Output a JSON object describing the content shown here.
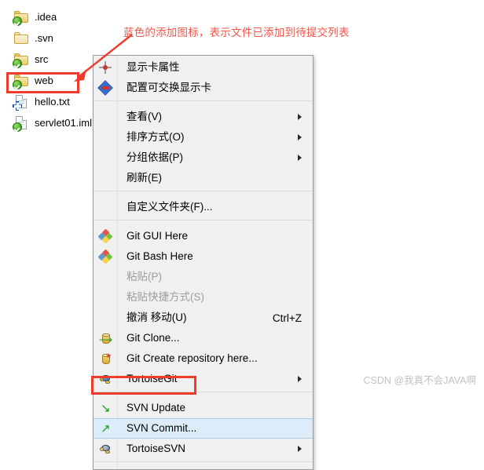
{
  "file_list": {
    "items": [
      {
        "label": ".idea",
        "icon": "folder-icon",
        "overlay": "green-check-overlay-icon"
      },
      {
        "label": ".svn",
        "icon": "folder-icon",
        "overlay": "none"
      },
      {
        "label": "src",
        "icon": "folder-icon",
        "overlay": "green-check-overlay-icon"
      },
      {
        "label": "web",
        "icon": "folder-icon",
        "overlay": "green-check-overlay-icon"
      },
      {
        "label": "hello.txt",
        "icon": "text-file-icon",
        "overlay": "blue-plus-overlay-icon"
      },
      {
        "label": "servlet01.iml",
        "icon": "file-icon",
        "overlay": "green-check-overlay-icon"
      }
    ]
  },
  "context_menu": {
    "items": [
      {
        "label": "显示卡属性",
        "icon": "display-properties-icon",
        "accel": "",
        "arrow": false,
        "disabled": false,
        "highlight": false,
        "separator_before": false
      },
      {
        "label": "配置可交换显示卡",
        "icon": "switchable-graphics-icon",
        "accel": "",
        "arrow": false,
        "disabled": false,
        "highlight": false,
        "separator_before": false
      },
      {
        "label": "查看(V)",
        "icon": "none",
        "accel": "",
        "arrow": true,
        "disabled": false,
        "highlight": false,
        "separator_before": true
      },
      {
        "label": "排序方式(O)",
        "icon": "none",
        "accel": "",
        "arrow": true,
        "disabled": false,
        "highlight": false,
        "separator_before": false
      },
      {
        "label": "分组依据(P)",
        "icon": "none",
        "accel": "",
        "arrow": true,
        "disabled": false,
        "highlight": false,
        "separator_before": false
      },
      {
        "label": "刷新(E)",
        "icon": "none",
        "accel": "",
        "arrow": false,
        "disabled": false,
        "highlight": false,
        "separator_before": false
      },
      {
        "label": "自定义文件夹(F)...",
        "icon": "none",
        "accel": "",
        "arrow": false,
        "disabled": false,
        "highlight": false,
        "separator_before": true
      },
      {
        "label": "Git GUI Here",
        "icon": "git-logo-icon",
        "accel": "",
        "arrow": false,
        "disabled": false,
        "highlight": false,
        "separator_before": true
      },
      {
        "label": "Git Bash Here",
        "icon": "git-logo-icon",
        "accel": "",
        "arrow": false,
        "disabled": false,
        "highlight": false,
        "separator_before": false
      },
      {
        "label": "粘贴(P)",
        "icon": "none",
        "accel": "",
        "arrow": false,
        "disabled": true,
        "highlight": false,
        "separator_before": false
      },
      {
        "label": "粘贴快捷方式(S)",
        "icon": "none",
        "accel": "",
        "arrow": false,
        "disabled": true,
        "highlight": false,
        "separator_before": false
      },
      {
        "label": "撤消 移动(U)",
        "icon": "none",
        "accel": "Ctrl+Z",
        "arrow": false,
        "disabled": false,
        "highlight": false,
        "separator_before": false
      },
      {
        "label": "Git Clone...",
        "icon": "git-clone-icon",
        "accel": "",
        "arrow": false,
        "disabled": false,
        "highlight": false,
        "separator_before": false
      },
      {
        "label": "Git Create repository here...",
        "icon": "git-create-repo-icon",
        "accel": "",
        "arrow": false,
        "disabled": false,
        "highlight": false,
        "separator_before": false
      },
      {
        "label": "TortoiseGit",
        "icon": "tortoisegit-turtle-icon",
        "accel": "",
        "arrow": true,
        "disabled": false,
        "highlight": false,
        "separator_before": false
      },
      {
        "label": "SVN Update",
        "icon": "svn-update-arrow-icon",
        "accel": "",
        "arrow": false,
        "disabled": false,
        "highlight": false,
        "separator_before": true
      },
      {
        "label": "SVN Commit...",
        "icon": "svn-commit-arrow-icon",
        "accel": "",
        "arrow": false,
        "disabled": false,
        "highlight": true,
        "separator_before": false
      },
      {
        "label": "TortoiseSVN",
        "icon": "tortoisesvn-turtle-icon",
        "accel": "",
        "arrow": true,
        "disabled": false,
        "highlight": false,
        "separator_before": false
      }
    ]
  },
  "annotations": {
    "note_text": "蓝色的添加图标，表示文件已添加到待提交列表",
    "note_color": "#f4554a",
    "box_color": "#ef3b2c",
    "highlight_color": "#dcedf9"
  },
  "watermark": {
    "text": "CSDN @我真不会JAVA啊"
  }
}
